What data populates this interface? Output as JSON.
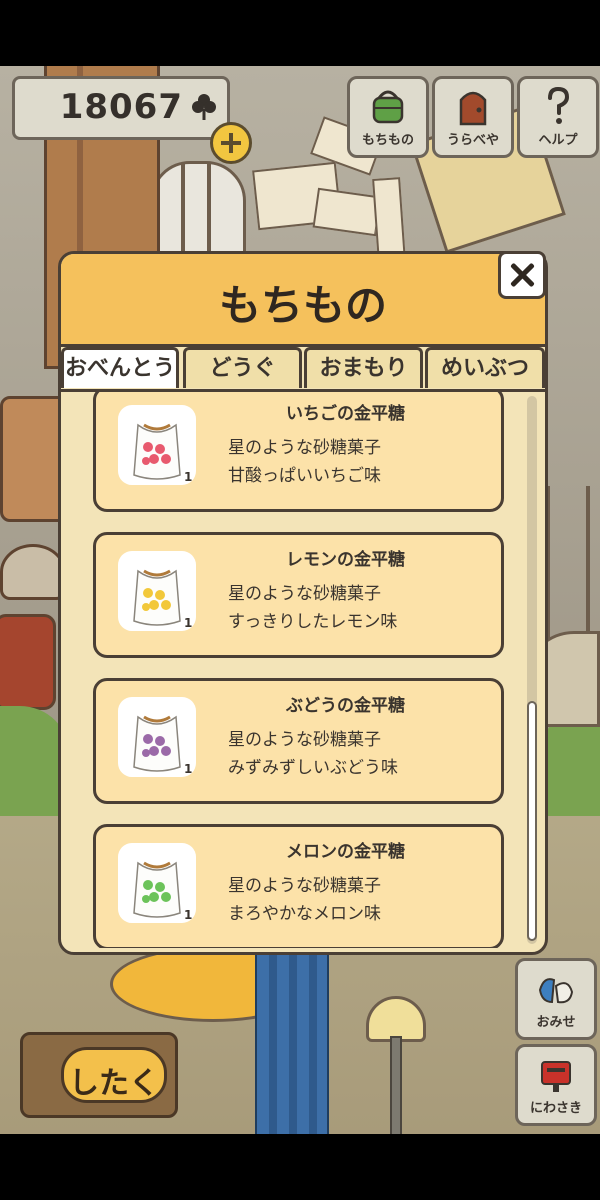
{
  "currency": {
    "amount": "18067",
    "icon": "clover-icon"
  },
  "top_menu": [
    {
      "label": "もちもの",
      "icon": "bag-icon"
    },
    {
      "label": "うらべや",
      "icon": "door-icon"
    },
    {
      "label": "ヘルプ",
      "icon": "question-icon"
    }
  ],
  "panel": {
    "title": "もちもの",
    "tabs": [
      "おべんとう",
      "どうぐ",
      "おまもり",
      "めいぶつ"
    ],
    "active_tab": "おべんとう",
    "items": [
      {
        "name": "いちごの金平糖",
        "desc1": "星のような砂糖菓子",
        "desc2": "甘酸っぱいいちご味",
        "color": "#e85a6e"
      },
      {
        "name": "レモンの金平糖",
        "desc1": "星のような砂糖菓子",
        "desc2": "すっきりしたレモン味",
        "color": "#f2c83a"
      },
      {
        "name": "ぶどうの金平糖",
        "desc1": "星のような砂糖菓子",
        "desc2": "みずみずしいぶどう味",
        "color": "#9b6aa8"
      },
      {
        "name": "メロンの金平糖",
        "desc1": "星のような砂糖菓子",
        "desc2": "まろやかなメロン味",
        "color": "#6cc35a"
      }
    ]
  },
  "side_menu": [
    {
      "label": "おみせ",
      "icon": "shop-icon"
    },
    {
      "label": "にわさき",
      "icon": "mailbox-icon"
    }
  ],
  "pack_button": {
    "label": "したく"
  }
}
